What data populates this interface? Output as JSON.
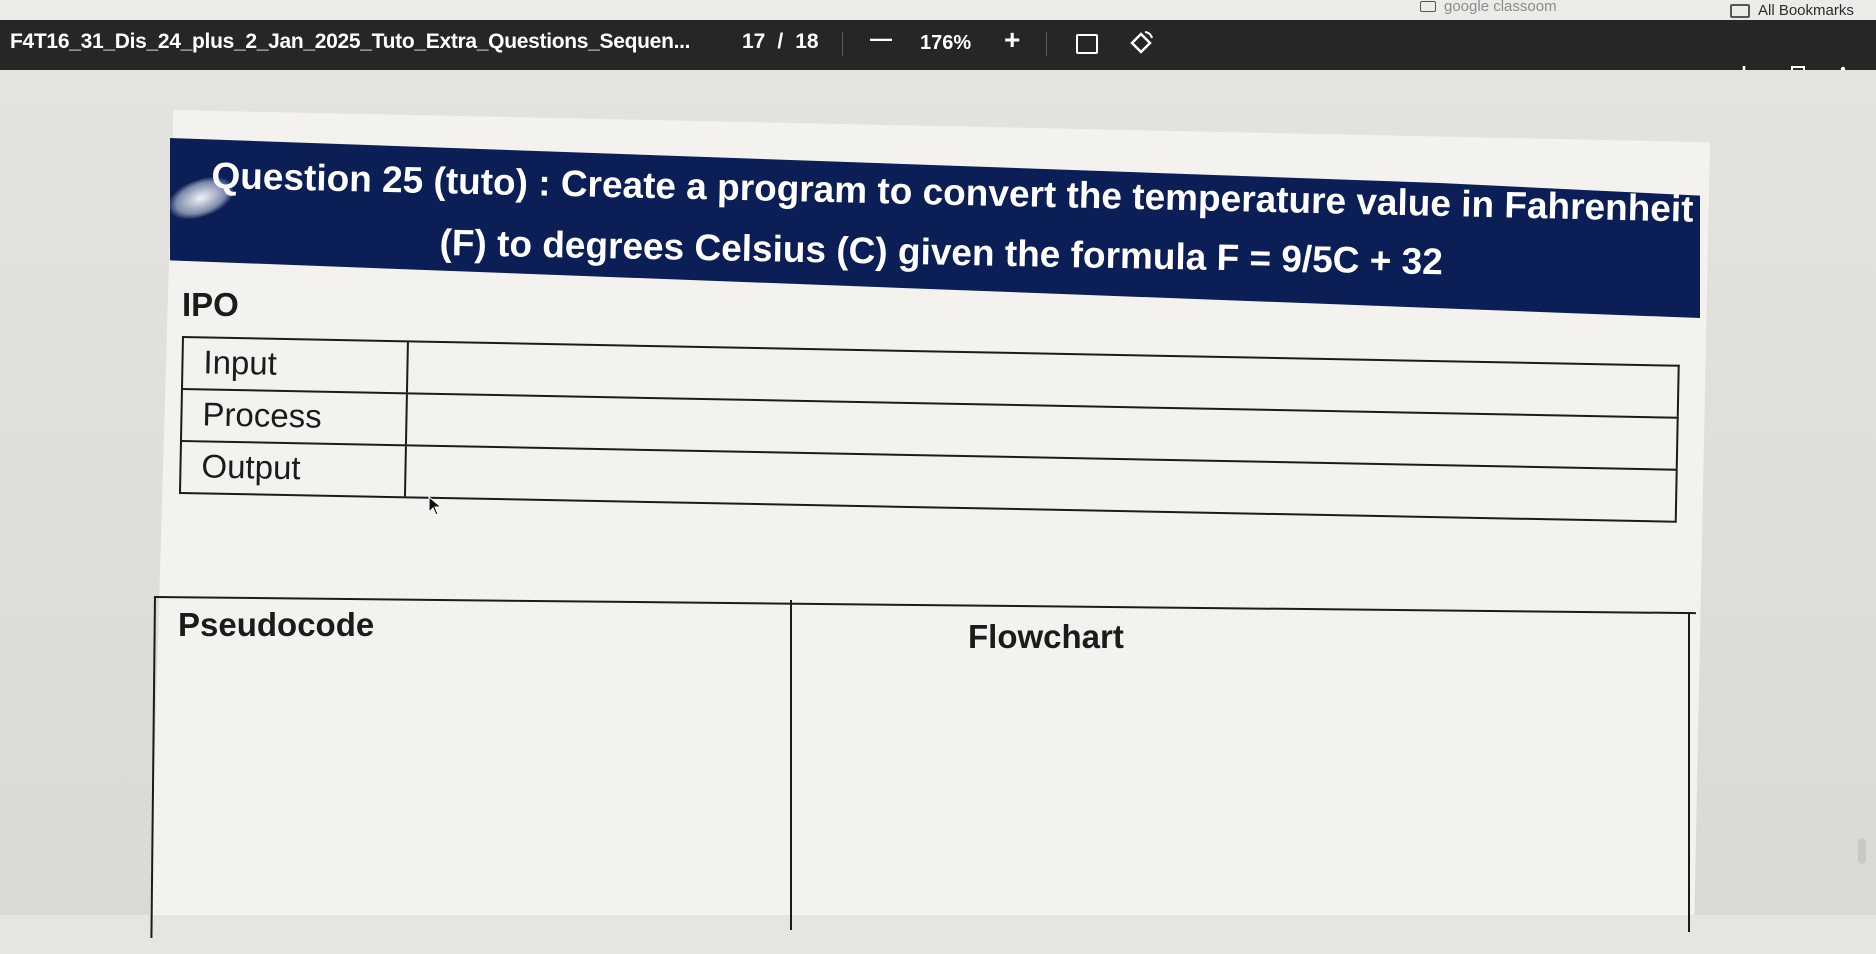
{
  "bookmarks": {
    "faded_item": "google classoom",
    "all_bookmarks": "All Bookmarks"
  },
  "toolbar": {
    "doc_title": "F4T16_31_Dis_24_plus_2_Jan_2025_Tuto_Extra_Questions_Sequen...",
    "current_page": "17",
    "page_separator": "/",
    "total_pages": "18",
    "zoom_out": "—",
    "zoom_value": "176%",
    "zoom_in": "+"
  },
  "document": {
    "question_line1": "Question 25 (tuto) : Create a program to convert the temperature value in Fahrenheit",
    "question_line2": "(F) to degrees Celsius (C) given the formula F = 9/5C + 32",
    "ipo_heading": "IPO",
    "ipo_rows": [
      {
        "label": "Input"
      },
      {
        "label": "Process"
      },
      {
        "label": "Output"
      }
    ],
    "pseudocode_label": "Pseudocode",
    "flowchart_label": "Flowchart"
  },
  "colors": {
    "banner": "#0b1f56",
    "toolbar": "#262626"
  }
}
